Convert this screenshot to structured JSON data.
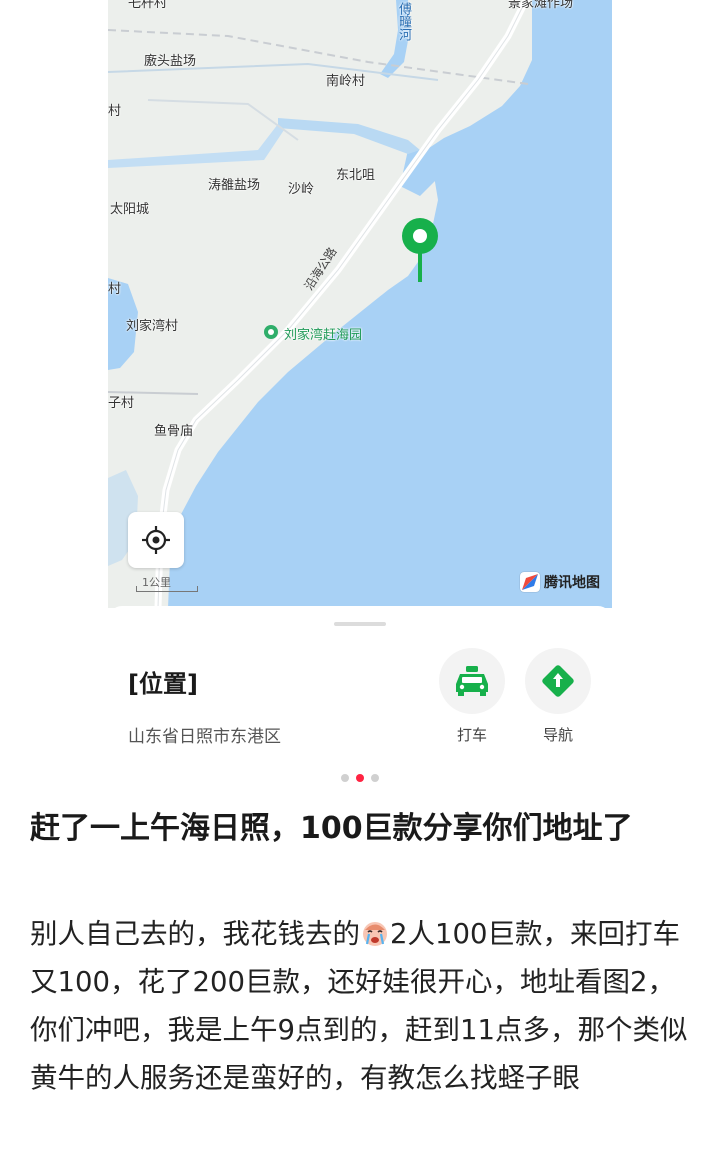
{
  "map": {
    "labels": [
      {
        "key": "maozi",
        "text": "乇杆村"
      },
      {
        "key": "jiaxi",
        "text": "景家滩作场"
      },
      {
        "key": "chuantong",
        "text": "傅疃河"
      },
      {
        "key": "mitou",
        "text": "廒头盐场"
      },
      {
        "key": "nanling",
        "text": "南岭村"
      },
      {
        "key": "dongbeiju",
        "text": "东北咀"
      },
      {
        "key": "taojun",
        "text": "涛雒盐场"
      },
      {
        "key": "shaling",
        "text": "沙岭"
      },
      {
        "key": "taiyang",
        "text": "太阳城"
      },
      {
        "key": "liujiawan",
        "text": "刘家湾村"
      },
      {
        "key": "zicun",
        "text": "子村"
      },
      {
        "key": "yugumiao",
        "text": "鱼骨庙"
      },
      {
        "key": "edge_cun1",
        "text": "村"
      },
      {
        "key": "edge_cun2",
        "text": "村"
      }
    ],
    "road_label": "沿海公路",
    "poi_label": "刘家湾赶海园",
    "scale_label": "1公里",
    "brand_label": "腾讯地图",
    "locate_icon": "crosshair-icon",
    "colors": {
      "water": "#a8d1f5",
      "land": "#ecefec",
      "pin": "#17b04b"
    }
  },
  "location": {
    "title": "[位置]",
    "address": "山东省日照市东港区"
  },
  "actions": {
    "taxi_label": "打车",
    "nav_label": "导航"
  },
  "pagination": {
    "total": 3,
    "active": 2
  },
  "post": {
    "title": "赶了一上午海日照，100巨款分享你们地址了",
    "body_part1": "别人自己去的，我花钱去的",
    "body_emoji": "crying-face-emoji",
    "body_part2": "2人100巨款，来回打车又100，花了200巨款，还好娃很开心，地址看图2，你们冲吧，我是上午9点到的，赶到11点多，那个类似黄牛的人服务还是蛮好的，有教怎么找蛏子眼"
  }
}
